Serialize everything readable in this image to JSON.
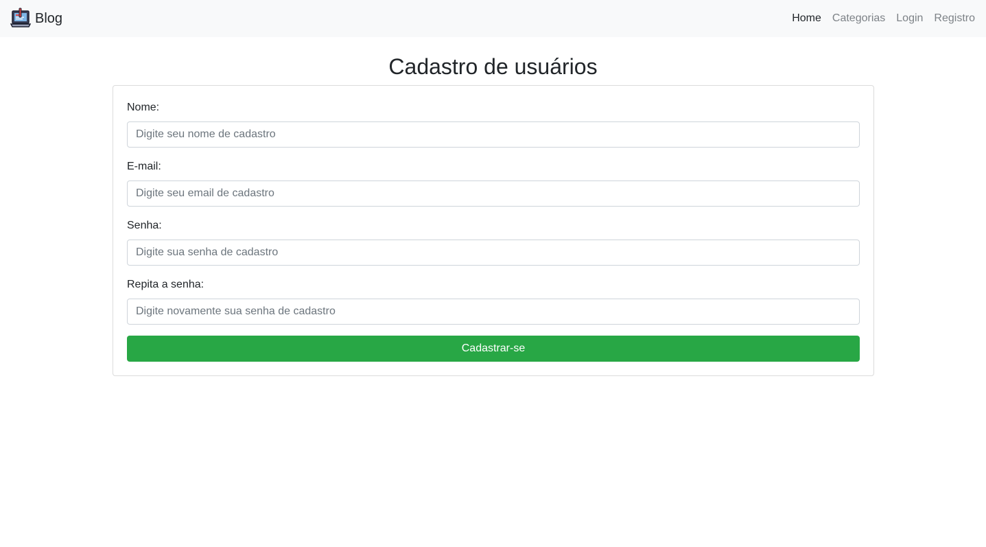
{
  "navbar": {
    "brand": {
      "icon": "laptop-blog-icon",
      "label": "Blog"
    },
    "links": [
      {
        "label": "Home",
        "active": true
      },
      {
        "label": "Categorias",
        "active": false
      },
      {
        "label": "Login",
        "active": false
      },
      {
        "label": "Registro",
        "active": false
      }
    ]
  },
  "page": {
    "title": "Cadastro de usuários"
  },
  "form": {
    "fields": [
      {
        "label": "Nome:",
        "placeholder": "Digite seu nome de cadastro",
        "value": ""
      },
      {
        "label": "E-mail:",
        "placeholder": "Digite seu email de cadastro",
        "value": ""
      },
      {
        "label": "Senha:",
        "placeholder": "Digite sua senha de cadastro",
        "value": ""
      },
      {
        "label": "Repita a senha:",
        "placeholder": "Digite novamente sua senha de cadastro",
        "value": ""
      }
    ],
    "submit_label": "Cadastrar-se"
  },
  "colors": {
    "navbar_bg": "#f8f9fa",
    "nav_active": "#212529",
    "nav_inactive": "#7d8287",
    "submit_bg": "#28a745",
    "submit_text": "#ffffff"
  }
}
